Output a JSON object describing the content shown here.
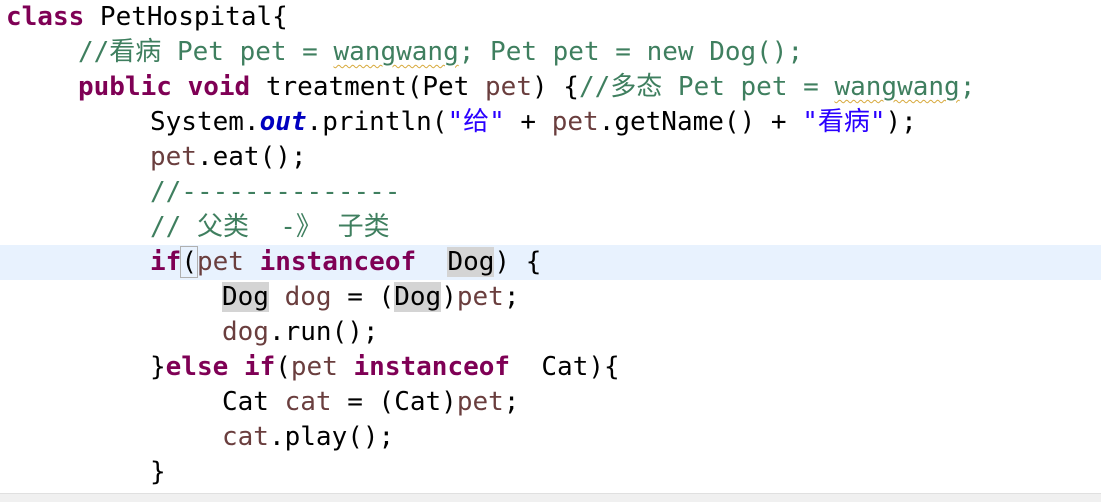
{
  "editor": {
    "lines": [
      {
        "tokens": [
          {
            "t": "class",
            "c": "kw"
          },
          {
            "t": " PetHospital{"
          }
        ]
      },
      {
        "tokens": [
          {
            "t": "//看病 Pet pet = ",
            "c": "cm"
          },
          {
            "t": "wangwang",
            "c": "cm sq"
          },
          {
            "t": "; Pet pet = new Dog();",
            "c": "cm"
          }
        ]
      },
      {
        "tokens": [
          {
            "t": "public",
            "c": "kw"
          },
          {
            "t": " "
          },
          {
            "t": "void",
            "c": "kw"
          },
          {
            "t": " treatment(Pet "
          },
          {
            "t": "pet",
            "c": "var"
          },
          {
            "t": ") {"
          },
          {
            "t": "//多态 Pet pet = ",
            "c": "cm"
          },
          {
            "t": "wangwang",
            "c": "cm sq"
          },
          {
            "t": ";",
            "c": "cm"
          }
        ]
      },
      {
        "tokens": [
          {
            "t": "System."
          },
          {
            "t": "out",
            "c": "fld"
          },
          {
            "t": ".println("
          },
          {
            "t": "\"给\"",
            "c": "str"
          },
          {
            "t": " + "
          },
          {
            "t": "pet",
            "c": "var"
          },
          {
            "t": ".getName() + "
          },
          {
            "t": "\"看病\"",
            "c": "str"
          },
          {
            "t": ");"
          }
        ]
      },
      {
        "tokens": [
          {
            "t": "pet",
            "c": "var"
          },
          {
            "t": ".eat();"
          }
        ]
      },
      {
        "tokens": [
          {
            "t": "//--------------",
            "c": "cm"
          }
        ]
      },
      {
        "tokens": [
          {
            "t": "// 父类  -》 子类",
            "c": "cm"
          }
        ]
      },
      {
        "tokens": [
          {
            "t": "if",
            "c": "kw"
          },
          {
            "t": "(",
            "c": "brk"
          },
          {
            "t": "pet",
            "c": "var"
          },
          {
            "t": " "
          },
          {
            "t": "instanceof",
            "c": "kw"
          },
          {
            "t": "  "
          },
          {
            "t": "Dog",
            "c": "mark"
          },
          {
            "t": ") {"
          }
        ]
      },
      {
        "tokens": [
          {
            "t": "Dog",
            "c": "mark"
          },
          {
            "t": " "
          },
          {
            "t": "dog",
            "c": "var"
          },
          {
            "t": " = ("
          },
          {
            "t": "Dog",
            "c": "mark"
          },
          {
            "t": ")"
          },
          {
            "t": "pet",
            "c": "var"
          },
          {
            "t": ";"
          }
        ]
      },
      {
        "tokens": [
          {
            "t": "dog",
            "c": "var"
          },
          {
            "t": ".run();"
          }
        ]
      },
      {
        "tokens": [
          {
            "t": "}"
          },
          {
            "t": "else",
            "c": "kw"
          },
          {
            "t": " "
          },
          {
            "t": "if",
            "c": "kw"
          },
          {
            "t": "("
          },
          {
            "t": "pet",
            "c": "var"
          },
          {
            "t": " "
          },
          {
            "t": "instanceof",
            "c": "kw"
          },
          {
            "t": "  Cat){"
          }
        ]
      },
      {
        "tokens": [
          {
            "t": "Cat "
          },
          {
            "t": "cat",
            "c": "var"
          },
          {
            "t": " = (Cat)"
          },
          {
            "t": "pet",
            "c": "var"
          },
          {
            "t": ";"
          }
        ]
      },
      {
        "tokens": [
          {
            "t": "cat",
            "c": "var"
          },
          {
            "t": ".play();"
          }
        ]
      },
      {
        "tokens": [
          {
            "t": "}"
          }
        ]
      }
    ]
  }
}
